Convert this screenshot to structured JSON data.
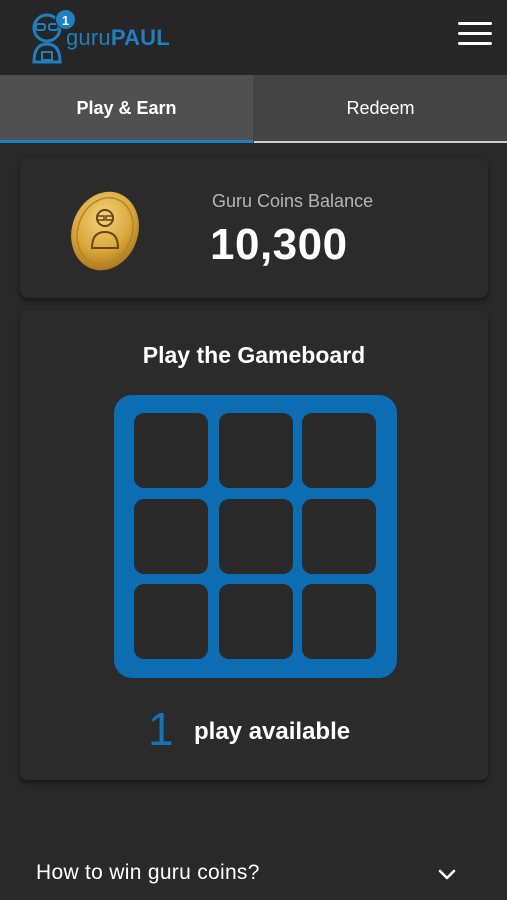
{
  "header": {
    "logo_icon": "guru-avatar-icon",
    "notification_count": "1",
    "brand_prefix": "guru",
    "brand_suffix": "PAUL",
    "menu_icon": "hamburger-menu-icon"
  },
  "tabs": [
    {
      "label": "Play & Earn",
      "active": true
    },
    {
      "label": "Redeem",
      "active": false
    }
  ],
  "balance": {
    "label": "Guru Coins Balance",
    "value": "10,300",
    "icon": "gold-coin-icon"
  },
  "game": {
    "title": "Play the Gameboard",
    "grid_rows": 3,
    "grid_cols": 3,
    "plays_count": "1",
    "plays_text": "play available"
  },
  "faq": {
    "question": "How to win guru coins?",
    "icon": "chevron-down-icon"
  },
  "colors": {
    "accent": "#1f7fc0",
    "board": "#0d6db3",
    "background": "#292929",
    "card": "#2b2b2b",
    "coin": "#e0b54a"
  }
}
